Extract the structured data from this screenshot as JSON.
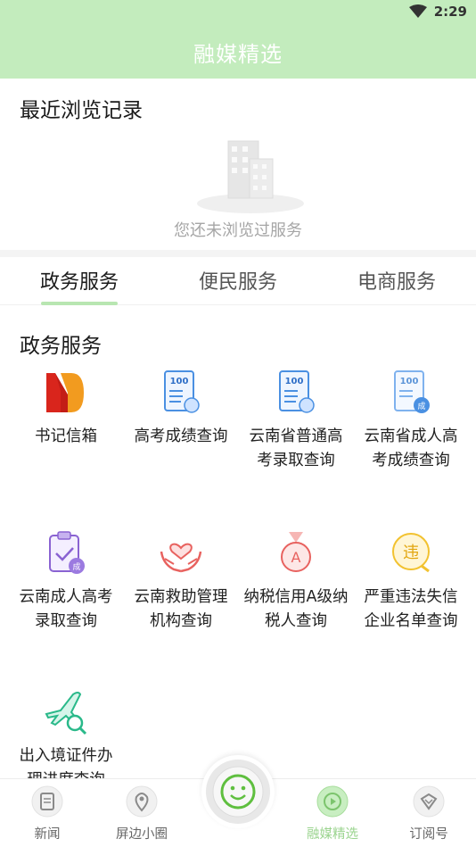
{
  "status_bar": {
    "time": "2:29",
    "icons": [
      "wifi-icon",
      "battery-icon"
    ]
  },
  "app_bar": {
    "title": "融媒精选"
  },
  "recent": {
    "title": "最近浏览记录",
    "empty_text": "您还未浏览过服务"
  },
  "tabs": [
    {
      "label": "政务服务",
      "active": true
    },
    {
      "label": "便民服务",
      "active": false
    },
    {
      "label": "电商服务",
      "active": false
    }
  ],
  "gov_section": {
    "title": "政务服务",
    "items": [
      {
        "label": "书记信箱",
        "icon": "mailbox-logo-icon"
      },
      {
        "label": "高考成绩查询",
        "icon": "score-report-icon",
        "badge": "100"
      },
      {
        "label": "云南省普通高考录取查询",
        "icon": "admission-report-icon",
        "badge": "100"
      },
      {
        "label": "云南省成人高考成绩查询",
        "icon": "adult-score-icon",
        "badge": "100",
        "stamp": "成"
      },
      {
        "label": "云南成人高考录取查询",
        "icon": "clipboard-check-icon",
        "stamp": "成"
      },
      {
        "label": "云南救助管理机构查询",
        "icon": "heart-hands-icon"
      },
      {
        "label": "纳税信用A级纳税人查询",
        "icon": "medal-a-icon",
        "medal_text": "A"
      },
      {
        "label": "严重违法失信企业名单查询",
        "icon": "violation-badge-icon",
        "badge_text": "违"
      },
      {
        "label": "出入境证件办理进度查询",
        "icon": "plane-search-icon"
      }
    ]
  },
  "bottom_nav": [
    {
      "label": "新闻",
      "icon": "news-icon",
      "active": false
    },
    {
      "label": "屏边小圈",
      "icon": "location-pin-icon",
      "active": false
    },
    {
      "label": "融媒精选",
      "icon": "play-icon",
      "active": true
    },
    {
      "label": "订阅号",
      "icon": "subscription-icon",
      "active": false
    }
  ],
  "center_button": {
    "icon": "smiley-icon"
  },
  "colors": {
    "header_bg": "#c3ecbd",
    "accent": "#9bd48f",
    "tab_underline": "#b8e6b1",
    "muted_text": "#a6a6a6"
  }
}
